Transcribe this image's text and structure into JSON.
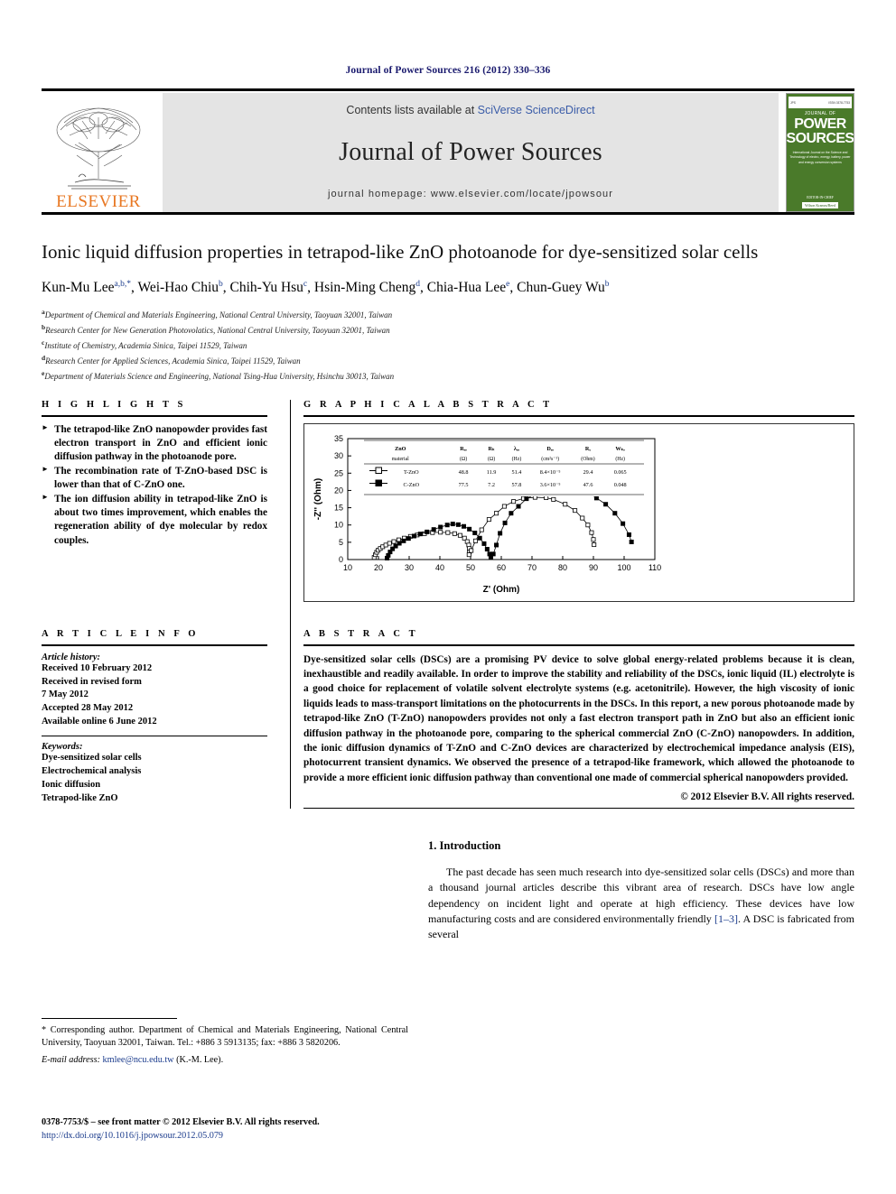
{
  "running_head": "Journal of Power Sources 216 (2012) 330–336",
  "masthead": {
    "publisher": "ELSEVIER",
    "contents_prefix": "Contents lists available at ",
    "contents_link": "SciVerse ScienceDirect",
    "journal_name": "Journal of Power Sources",
    "homepage": "journal homepage: www.elsevier.com/locate/jpowsour",
    "cover": {
      "top_left": "JPS",
      "top_right": "ISSN 0378-7753",
      "kicker": "JOURNAL OF",
      "line1": "POWER",
      "line2": "SOURCES",
      "blurb": "International Journal on the Science and Technology of electro, energy, battery, power and energy conversion systems",
      "editors_label": "EDITOR-IN-CHIEF",
      "editors": "Wilson Kramm/Reed"
    }
  },
  "article": {
    "title": "Ionic liquid diffusion properties in tetrapod-like ZnO photoanode for dye-sensitized solar cells",
    "authors_html": "Kun-Mu Lee<sup>a,b,*</sup>, Wei-Hao Chiu<sup>b</sup>, Chih-Yu Hsu<sup>c</sup>, Hsin-Ming Cheng<sup>d</sup>, Chia-Hua Lee<sup>e</sup>, Chun-Guey Wu<sup>b</sup>",
    "affiliations": [
      {
        "mark": "a",
        "text": "Department of Chemical and Materials Engineering, National Central University, Taoyuan 32001, Taiwan"
      },
      {
        "mark": "b",
        "text": "Research Center for New Generation Photovolatics, National Central University, Taoyuan 32001, Taiwan"
      },
      {
        "mark": "c",
        "text": "Institute of Chemistry, Academia Sinica, Taipei 11529, Taiwan"
      },
      {
        "mark": "d",
        "text": "Research Center for Applied Sciences, Academia Sinica, Taipei 11529, Taiwan"
      },
      {
        "mark": "e",
        "text": "Department of Materials Science and Engineering, National Tsing-Hua University, Hsinchu 30013, Taiwan"
      }
    ]
  },
  "highlights": {
    "heading": "H I G H L I G H T S",
    "items": [
      "The tetrapod-like ZnO nanopowder provides fast electron transport in ZnO and efficient ionic diffusion pathway in the photoanode pore.",
      "The recombination rate of T-ZnO-based DSC is lower than that of C-ZnO one.",
      "The ion diffusion ability in tetrapod-like ZnO is about two times improvement, which enables the regeneration ability of dye molecular by redox couples."
    ]
  },
  "graphical_abstract": {
    "heading": "G R A P H I C A L   A B S T R A C T"
  },
  "chart_data": {
    "type": "scatter",
    "title": "",
    "xlabel": "Z' (Ohm)",
    "ylabel": "-Z'' (Ohm)",
    "xlim": [
      10,
      110
    ],
    "ylim": [
      0,
      35
    ],
    "xticks": [
      10,
      20,
      30,
      40,
      50,
      60,
      70,
      80,
      90,
      100,
      110
    ],
    "yticks": [
      0,
      5,
      10,
      15,
      20,
      25,
      30,
      35
    ],
    "grid": false,
    "legend_position": "inset-top",
    "series": [
      {
        "name": "T-ZnO",
        "marker": "open-square",
        "points": [
          [
            18.6,
            0.6
          ],
          [
            19.0,
            1.4
          ],
          [
            19.4,
            2.1
          ],
          [
            19.9,
            2.7
          ],
          [
            20.6,
            3.2
          ],
          [
            21.4,
            3.7
          ],
          [
            22.4,
            4.2
          ],
          [
            23.6,
            4.7
          ],
          [
            25.0,
            5.2
          ],
          [
            26.6,
            5.7
          ],
          [
            28.4,
            6.2
          ],
          [
            30.4,
            6.7
          ],
          [
            32.6,
            7.1
          ],
          [
            35.0,
            7.5
          ],
          [
            37.6,
            7.8
          ],
          [
            40.2,
            7.9
          ],
          [
            42.6,
            7.8
          ],
          [
            44.8,
            7.5
          ],
          [
            46.6,
            7.0
          ],
          [
            48.0,
            6.2
          ],
          [
            48.9,
            5.2
          ],
          [
            49.4,
            4.2
          ],
          [
            49.6,
            3.2
          ],
          [
            49.6,
            2.2
          ],
          [
            49.5,
            1.4
          ],
          [
            50.2,
            2.6
          ],
          [
            51.6,
            5.4
          ],
          [
            53.6,
            8.6
          ],
          [
            56.0,
            11.6
          ],
          [
            58.4,
            13.4
          ],
          [
            61.0,
            15.4
          ],
          [
            64.0,
            16.8
          ],
          [
            67.2,
            17.7
          ],
          [
            71.0,
            18.0
          ],
          [
            74.6,
            17.9
          ],
          [
            77.0,
            17.4
          ],
          [
            80.8,
            16.0
          ],
          [
            84.0,
            14.2
          ],
          [
            86.4,
            12.0
          ],
          [
            88.2,
            10.0
          ],
          [
            89.4,
            7.8
          ],
          [
            90.0,
            5.8
          ],
          [
            90.2,
            4.3
          ]
        ]
      },
      {
        "name": "C-ZnO",
        "marker": "filled-square",
        "points": [
          [
            22.8,
            0.4
          ],
          [
            23.2,
            1.2
          ],
          [
            23.8,
            2.2
          ],
          [
            24.6,
            3.1
          ],
          [
            25.6,
            3.9
          ],
          [
            26.8,
            4.7
          ],
          [
            28.2,
            5.4
          ],
          [
            29.8,
            6.1
          ],
          [
            31.6,
            6.8
          ],
          [
            33.6,
            7.4
          ],
          [
            35.8,
            8.0
          ],
          [
            38.0,
            8.7
          ],
          [
            40.2,
            9.4
          ],
          [
            42.4,
            10.0
          ],
          [
            44.2,
            10.3
          ],
          [
            46.0,
            10.1
          ],
          [
            47.8,
            9.6
          ],
          [
            49.6,
            8.8
          ],
          [
            51.4,
            7.7
          ],
          [
            53.0,
            6.2
          ],
          [
            54.4,
            4.6
          ],
          [
            55.4,
            3.0
          ],
          [
            56.2,
            1.6
          ],
          [
            56.6,
            0.7
          ],
          [
            57.4,
            1.6
          ],
          [
            58.4,
            4.2
          ],
          [
            59.6,
            7.6
          ],
          [
            61.2,
            10.6
          ],
          [
            63.2,
            13.4
          ],
          [
            65.6,
            15.4
          ],
          [
            68.2,
            17.6
          ],
          [
            71.2,
            19.0
          ],
          [
            74.6,
            20.5
          ],
          [
            78.2,
            20.8
          ],
          [
            82.0,
            21.0
          ],
          [
            84.6,
            20.5
          ],
          [
            88.0,
            19.6
          ],
          [
            91.0,
            17.8
          ],
          [
            94.0,
            16.0
          ],
          [
            97.0,
            13.4
          ],
          [
            99.6,
            10.4
          ],
          [
            101.6,
            7.2
          ],
          [
            102.4,
            5.1
          ]
        ]
      }
    ],
    "inset_table": {
      "header_row1": [
        "ZnO",
        "Rₑₑ",
        "Rₖ",
        "λₑₑ",
        "Dₑₑ",
        "Rₒ",
        "Wₖₑ"
      ],
      "header_row2": [
        "material",
        "(Ω)",
        "(Ω)",
        "(Hz)",
        "(cm²s⁻¹)",
        "(Ohm)",
        "(Hz)"
      ],
      "rows": [
        {
          "marker": "open-square",
          "label": "T-ZnO",
          "values": [
            "48.8",
            "11.9",
            "51.4",
            "8.4×10⁻⁵",
            "29.4",
            "0.065"
          ]
        },
        {
          "marker": "filled-square",
          "label": "C-ZnO",
          "values": [
            "77.5",
            "7.2",
            "57.8",
            "3.6×10⁻⁵",
            "47.6",
            "0.048"
          ]
        }
      ]
    }
  },
  "article_info": {
    "heading": "A R T I C L E   I N F O",
    "history_label": "Article history:",
    "history": [
      "Received 10 February 2012",
      "Received in revised form",
      "7 May 2012",
      "Accepted 28 May 2012",
      "Available online 6 June 2012"
    ],
    "keywords_label": "Keywords:",
    "keywords": [
      "Dye-sensitized solar cells",
      "Electrochemical analysis",
      "Ionic diffusion",
      "Tetrapod-like ZnO"
    ]
  },
  "abstract": {
    "heading": "A B S T R A C T",
    "text": "Dye-sensitized solar cells (DSCs) are a promising PV device to solve global energy-related problems because it is clean, inexhaustible and readily available. In order to improve the stability and reliability of the DSCs, ionic liquid (IL) electrolyte is a good choice for replacement of volatile solvent electrolyte systems (e.g. acetonitrile). However, the high viscosity of ionic liquids leads to mass-transport limitations on the photocurrents in the DSCs. In this report, a new porous photoanode made by tetrapod-like ZnO (T-ZnO) nanopowders provides not only a fast electron transport path in ZnO but also an efficient ionic diffusion pathway in the photoanode pore, comparing to the spherical commercial ZnO (C-ZnO) nanopowders. In addition, the ionic diffusion dynamics of T-ZnO and C-ZnO devices are characterized by electrochemical impedance analysis (EIS), photocurrent transient dynamics. We observed the presence of a tetrapod-like framework, which allowed the photoanode to provide a more efficient ionic diffusion pathway than conventional one made of commercial spherical nanopowders provided.",
    "copyright": "© 2012 Elsevier B.V. All rights reserved."
  },
  "introduction": {
    "heading": "1. Introduction",
    "paragraph_html": "The past decade has seen much research into dye-sensitized solar cells (DSCs) and more than a thousand journal articles describe this vibrant area of research. DSCs have low angle dependency on incident light and operate at high efficiency. These devices have low manufacturing costs and are considered environmentally friendly <span class=\"ref\">[1&ndash;3]</span>. A DSC is fabricated from several"
  },
  "footnote": {
    "corresponding": "* Corresponding author. Department of Chemical and Materials Engineering, National Central University, Taoyuan 32001, Taiwan. Tel.: +886 3 5913135; fax: +886 3 5820206.",
    "email_label": "E-mail address:",
    "email": "kmlee@ncu.edu.tw",
    "email_suffix": "(K.-M. Lee)."
  },
  "imprint": {
    "line1": "0378-7753/$ – see front matter © 2012 Elsevier B.V. All rights reserved.",
    "doi": "http://dx.doi.org/10.1016/j.jpowsour.2012.05.079"
  }
}
